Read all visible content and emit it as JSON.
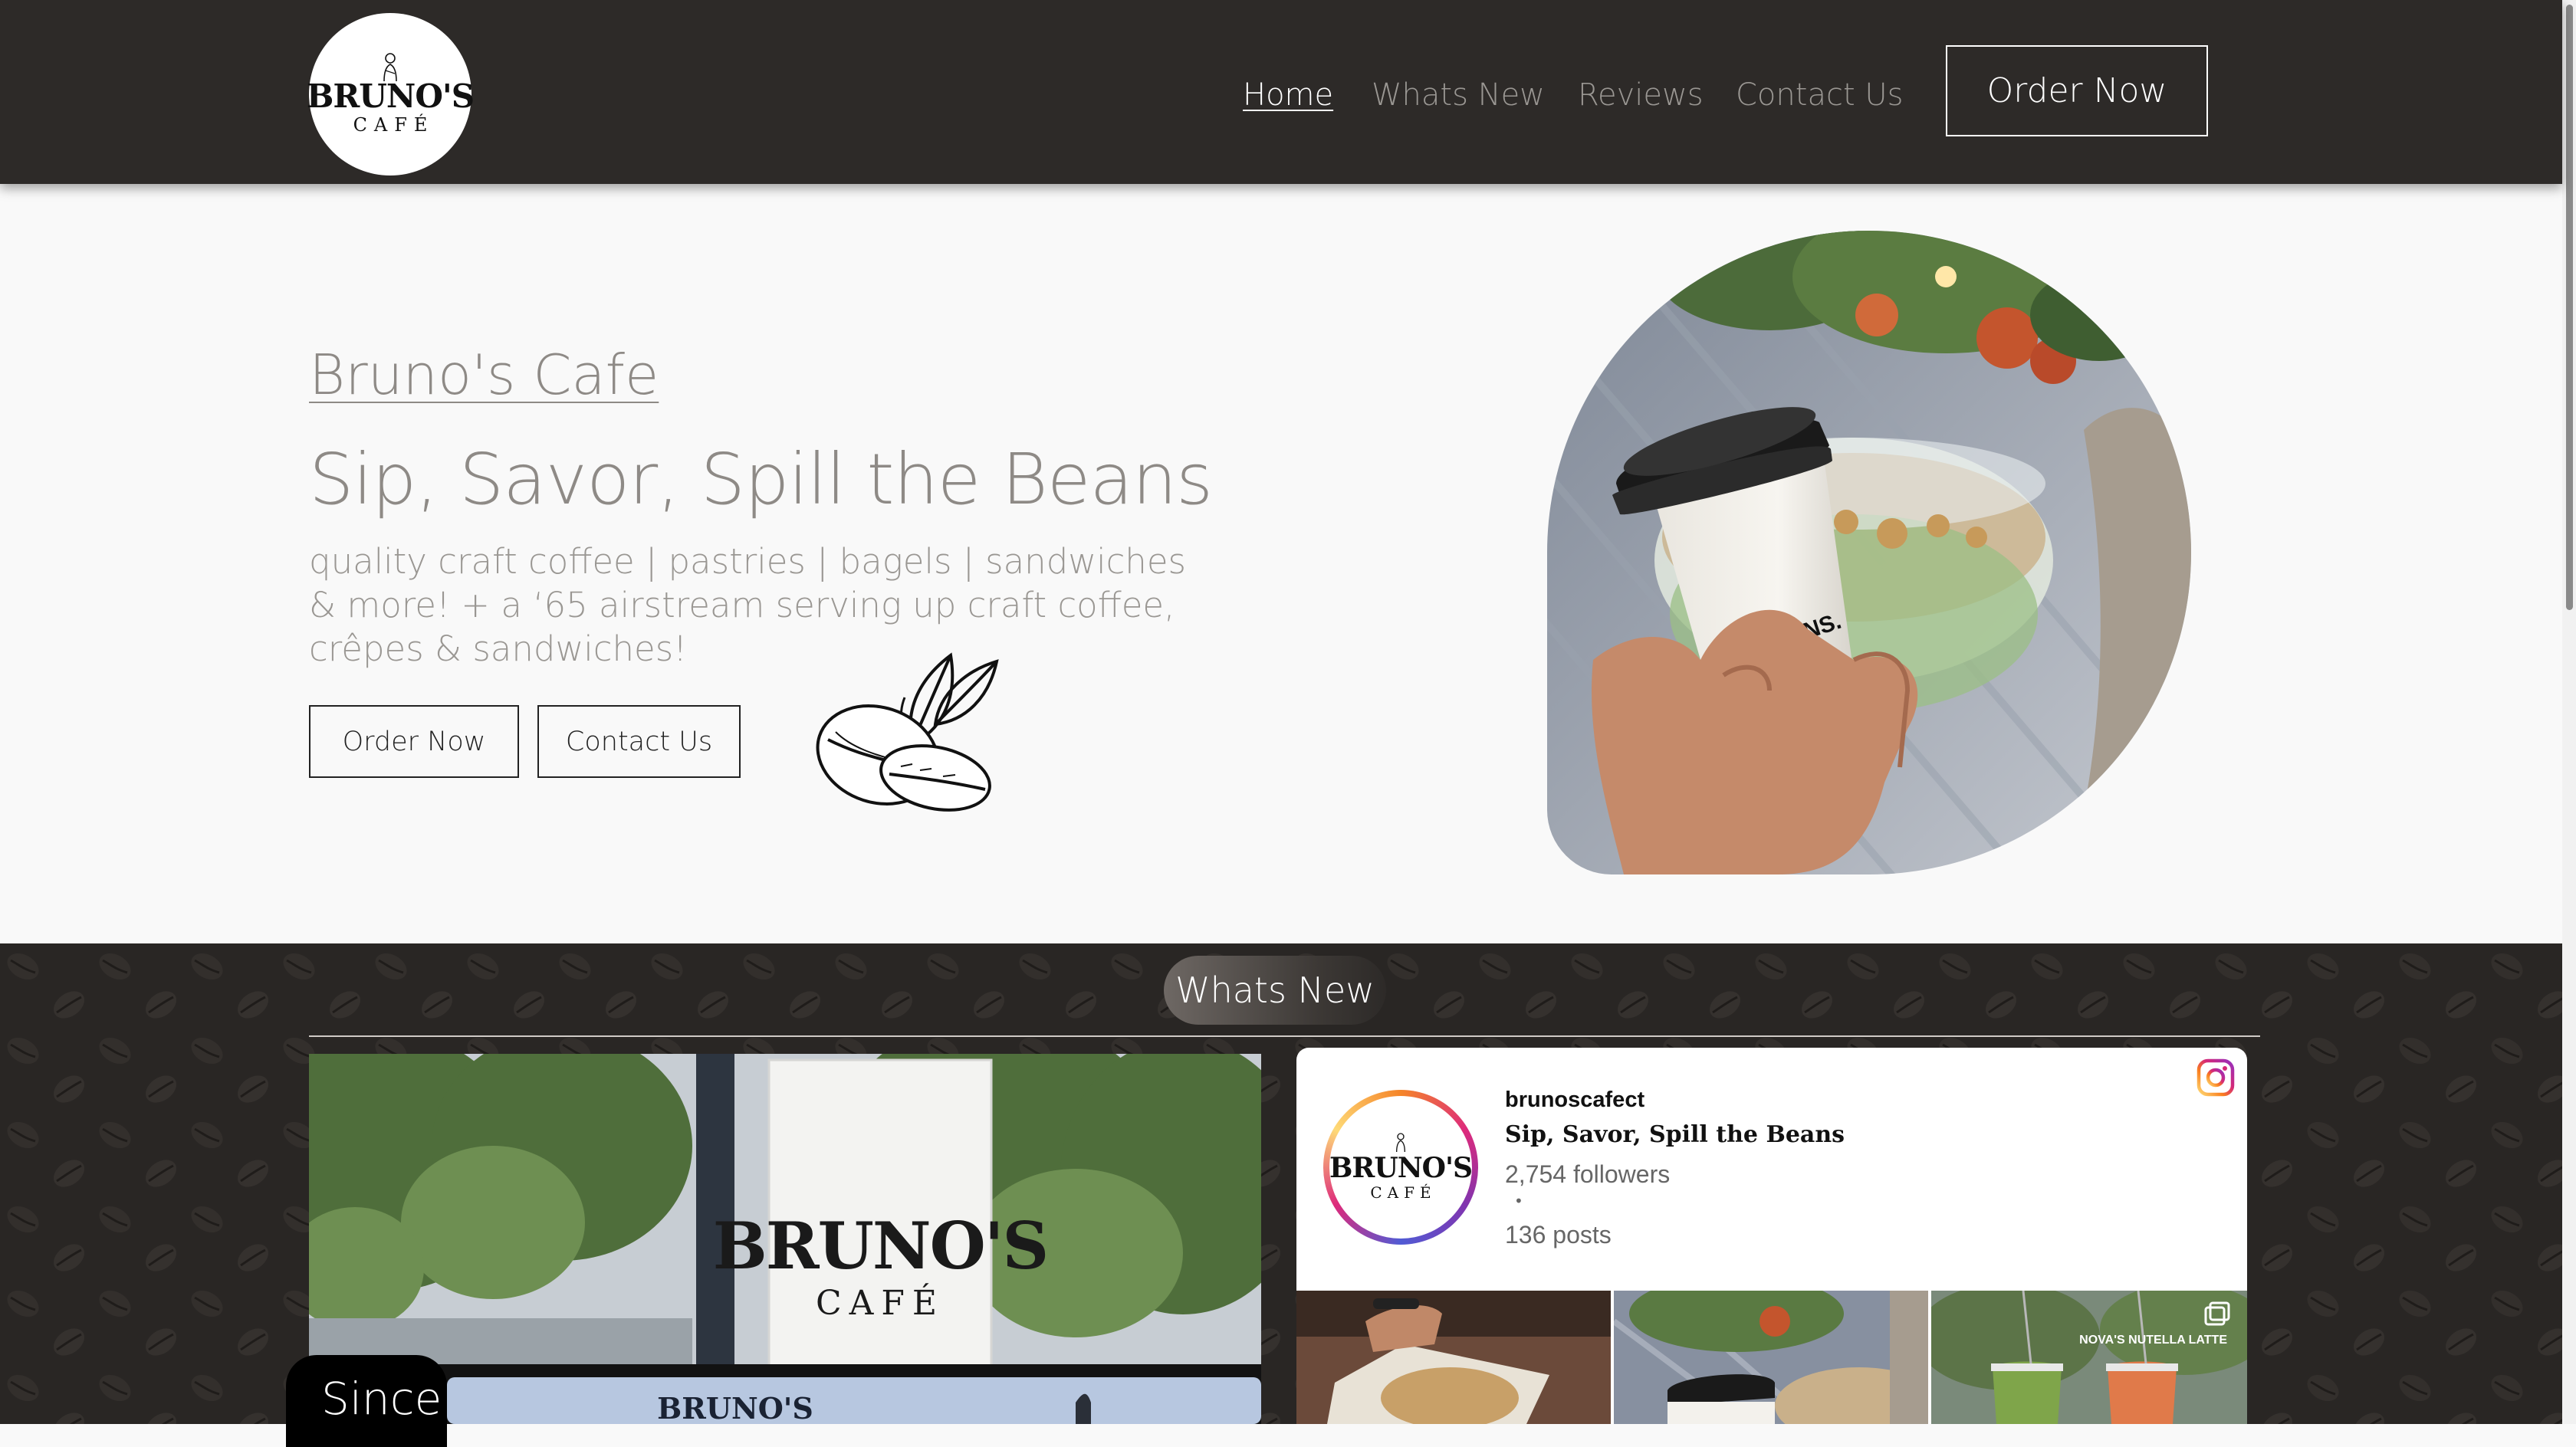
{
  "header": {
    "logo": {
      "name": "BRUNO'S",
      "sub": "CAFÉ"
    },
    "nav": [
      {
        "label": "Home",
        "active": true
      },
      {
        "label": "Whats New",
        "active": false
      },
      {
        "label": "Reviews",
        "active": false
      },
      {
        "label": "Contact Us",
        "active": false
      }
    ],
    "order_label": "Order Now"
  },
  "hero": {
    "title": "Bruno's Cafe",
    "tagline": "Sip, Savor, Spill the Beans",
    "description": "quality craft coffee | pastries | bagels | sandwiches & more! + a ‘65 airstream serving up craft coffee, crêpes & sandwiches!",
    "buttons": {
      "order": "Order Now",
      "contact": "Contact Us"
    },
    "cup_print": "SPILL THE BEANS."
  },
  "whats_new": {
    "heading": "Whats New",
    "sign": {
      "name": "BRUNO'S",
      "sub": "CAFÉ"
    },
    "trailer_text": "BRUNO'S",
    "since_label": "Since"
  },
  "instagram": {
    "handle": "brunoscafect",
    "bio": "Sip, Savor, Spill the Beans",
    "followers": "2,754 followers",
    "separator": "•",
    "posts": "136 posts",
    "avatar": {
      "name": "BRUNO'S",
      "sub": "CAFÉ"
    },
    "thumb_caption": "NOVA'S NUTELLA LATTE"
  },
  "colors": {
    "header_bg": "#2d2a28",
    "hero_bg": "#f9f9f9",
    "muted_text": "#8e8a86",
    "dark_section": "#292624"
  }
}
